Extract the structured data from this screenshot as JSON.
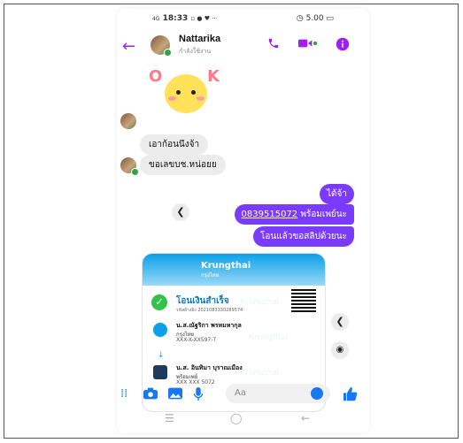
{
  "status_bar": {
    "time": "18:33",
    "left_extra": "4G ⁚⁚ ♥ ···",
    "right": "◷ 5.00 ▭"
  },
  "header": {
    "contact_name": "Nattarika",
    "contact_status": "กำลังใช้งาน"
  },
  "sticker": {
    "letter_o": "O",
    "letter_k": "K"
  },
  "messages_in": [
    {
      "text": "เอาก้อนนึงจ้า"
    },
    {
      "text": "ขอเลขบช.หน่อยย"
    }
  ],
  "messages_out": [
    {
      "text": "ได้จ้า"
    },
    {
      "link": "0839515072",
      "text": " พร้อมเพย์นะ"
    },
    {
      "text": "โอนแล้วขอสลิปด้วยนะ"
    }
  ],
  "slip": {
    "bank_brand": "Krungthai",
    "bank_brand_sub": "กรุงไทย",
    "title": "โอนเงินสำเร็จ",
    "ref": "รหัสอ้างอิง 2021083330289574",
    "sender_name": "น.ส.ณัฐริกา พรหมหากุล",
    "sender_bank": "กรุงไทย",
    "sender_account": "XXX-X-XX597-7",
    "receiver_name": "น.ส. อินทิมา บุราณเมือง",
    "receiver_bank": "พร้อมเพย์",
    "receiver_account": "XXX XXX 5072",
    "watermark": "Krungthai"
  },
  "composer": {
    "placeholder": "Aa"
  },
  "colors": {
    "accent": "#a020f0",
    "outgoing": "#7a3bff",
    "messenger_blue": "#1877f2"
  },
  "icons": {
    "back": "back-arrow-icon",
    "call": "phone-icon",
    "video": "video-icon",
    "info": "info-icon",
    "share": "share-icon",
    "camera": "camera-icon",
    "gallery": "image-icon",
    "mic": "mic-icon",
    "menu": "apps-icon",
    "emoji": "emoji-icon",
    "like": "thumbs-up-icon"
  }
}
